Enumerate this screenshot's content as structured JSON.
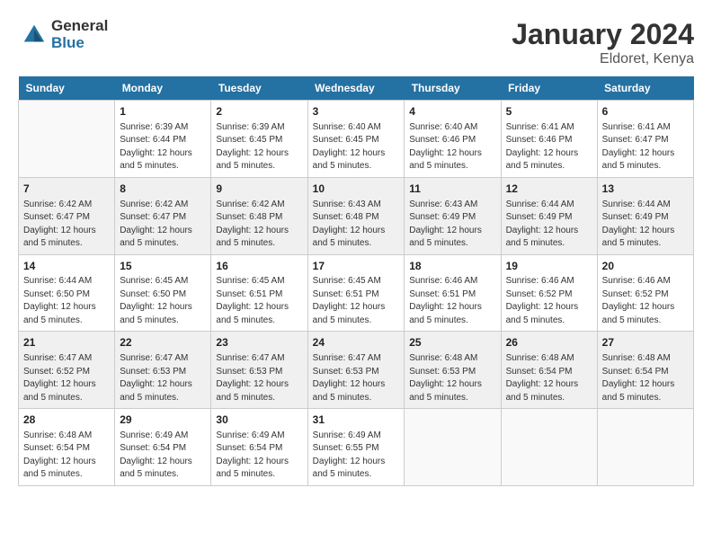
{
  "header": {
    "logo": {
      "general": "General",
      "blue": "Blue"
    },
    "title": "January 2024",
    "location": "Eldoret, Kenya"
  },
  "weekdays": [
    "Sunday",
    "Monday",
    "Tuesday",
    "Wednesday",
    "Thursday",
    "Friday",
    "Saturday"
  ],
  "weeks": [
    [
      {
        "day": "",
        "info": ""
      },
      {
        "day": "1",
        "info": "Sunrise: 6:39 AM\nSunset: 6:44 PM\nDaylight: 12 hours\nand 5 minutes."
      },
      {
        "day": "2",
        "info": "Sunrise: 6:39 AM\nSunset: 6:45 PM\nDaylight: 12 hours\nand 5 minutes."
      },
      {
        "day": "3",
        "info": "Sunrise: 6:40 AM\nSunset: 6:45 PM\nDaylight: 12 hours\nand 5 minutes."
      },
      {
        "day": "4",
        "info": "Sunrise: 6:40 AM\nSunset: 6:46 PM\nDaylight: 12 hours\nand 5 minutes."
      },
      {
        "day": "5",
        "info": "Sunrise: 6:41 AM\nSunset: 6:46 PM\nDaylight: 12 hours\nand 5 minutes."
      },
      {
        "day": "6",
        "info": "Sunrise: 6:41 AM\nSunset: 6:47 PM\nDaylight: 12 hours\nand 5 minutes."
      }
    ],
    [
      {
        "day": "7",
        "info": "Sunrise: 6:42 AM\nSunset: 6:47 PM\nDaylight: 12 hours\nand 5 minutes."
      },
      {
        "day": "8",
        "info": "Sunrise: 6:42 AM\nSunset: 6:47 PM\nDaylight: 12 hours\nand 5 minutes."
      },
      {
        "day": "9",
        "info": "Sunrise: 6:42 AM\nSunset: 6:48 PM\nDaylight: 12 hours\nand 5 minutes."
      },
      {
        "day": "10",
        "info": "Sunrise: 6:43 AM\nSunset: 6:48 PM\nDaylight: 12 hours\nand 5 minutes."
      },
      {
        "day": "11",
        "info": "Sunrise: 6:43 AM\nSunset: 6:49 PM\nDaylight: 12 hours\nand 5 minutes."
      },
      {
        "day": "12",
        "info": "Sunrise: 6:44 AM\nSunset: 6:49 PM\nDaylight: 12 hours\nand 5 minutes."
      },
      {
        "day": "13",
        "info": "Sunrise: 6:44 AM\nSunset: 6:49 PM\nDaylight: 12 hours\nand 5 minutes."
      }
    ],
    [
      {
        "day": "14",
        "info": "Sunrise: 6:44 AM\nSunset: 6:50 PM\nDaylight: 12 hours\nand 5 minutes."
      },
      {
        "day": "15",
        "info": "Sunrise: 6:45 AM\nSunset: 6:50 PM\nDaylight: 12 hours\nand 5 minutes."
      },
      {
        "day": "16",
        "info": "Sunrise: 6:45 AM\nSunset: 6:51 PM\nDaylight: 12 hours\nand 5 minutes."
      },
      {
        "day": "17",
        "info": "Sunrise: 6:45 AM\nSunset: 6:51 PM\nDaylight: 12 hours\nand 5 minutes."
      },
      {
        "day": "18",
        "info": "Sunrise: 6:46 AM\nSunset: 6:51 PM\nDaylight: 12 hours\nand 5 minutes."
      },
      {
        "day": "19",
        "info": "Sunrise: 6:46 AM\nSunset: 6:52 PM\nDaylight: 12 hours\nand 5 minutes."
      },
      {
        "day": "20",
        "info": "Sunrise: 6:46 AM\nSunset: 6:52 PM\nDaylight: 12 hours\nand 5 minutes."
      }
    ],
    [
      {
        "day": "21",
        "info": "Sunrise: 6:47 AM\nSunset: 6:52 PM\nDaylight: 12 hours\nand 5 minutes."
      },
      {
        "day": "22",
        "info": "Sunrise: 6:47 AM\nSunset: 6:53 PM\nDaylight: 12 hours\nand 5 minutes."
      },
      {
        "day": "23",
        "info": "Sunrise: 6:47 AM\nSunset: 6:53 PM\nDaylight: 12 hours\nand 5 minutes."
      },
      {
        "day": "24",
        "info": "Sunrise: 6:47 AM\nSunset: 6:53 PM\nDaylight: 12 hours\nand 5 minutes."
      },
      {
        "day": "25",
        "info": "Sunrise: 6:48 AM\nSunset: 6:53 PM\nDaylight: 12 hours\nand 5 minutes."
      },
      {
        "day": "26",
        "info": "Sunrise: 6:48 AM\nSunset: 6:54 PM\nDaylight: 12 hours\nand 5 minutes."
      },
      {
        "day": "27",
        "info": "Sunrise: 6:48 AM\nSunset: 6:54 PM\nDaylight: 12 hours\nand 5 minutes."
      }
    ],
    [
      {
        "day": "28",
        "info": "Sunrise: 6:48 AM\nSunset: 6:54 PM\nDaylight: 12 hours\nand 5 minutes."
      },
      {
        "day": "29",
        "info": "Sunrise: 6:49 AM\nSunset: 6:54 PM\nDaylight: 12 hours\nand 5 minutes."
      },
      {
        "day": "30",
        "info": "Sunrise: 6:49 AM\nSunset: 6:54 PM\nDaylight: 12 hours\nand 5 minutes."
      },
      {
        "day": "31",
        "info": "Sunrise: 6:49 AM\nSunset: 6:55 PM\nDaylight: 12 hours\nand 5 minutes."
      },
      {
        "day": "",
        "info": ""
      },
      {
        "day": "",
        "info": ""
      },
      {
        "day": "",
        "info": ""
      }
    ]
  ]
}
